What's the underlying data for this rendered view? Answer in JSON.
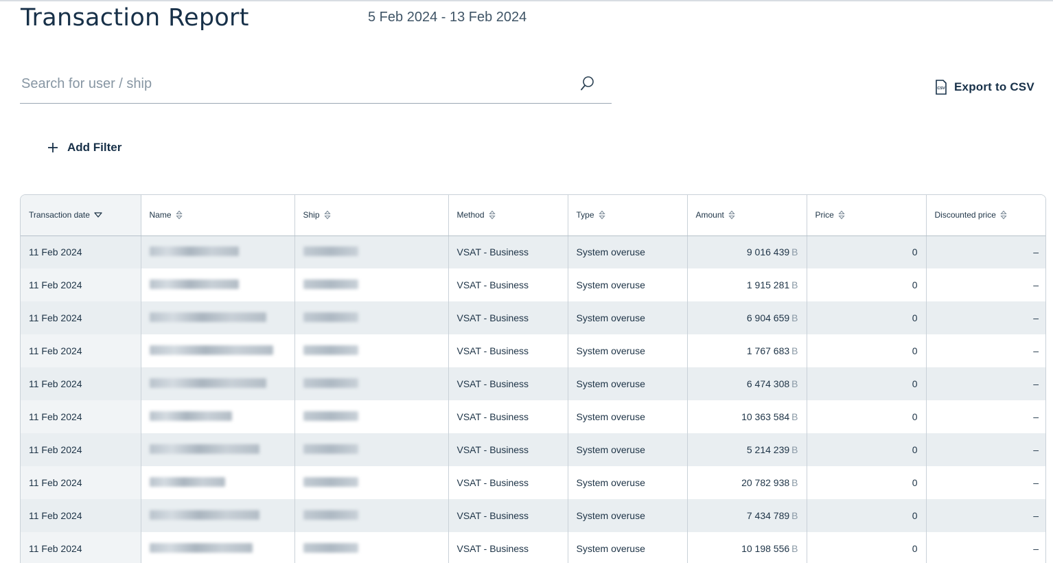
{
  "header": {
    "title": "Transaction Report",
    "date_range": "5 Feb 2024 - 13 Feb 2024"
  },
  "search": {
    "placeholder": "Search for user / ship",
    "value": ""
  },
  "actions": {
    "export_label": "Export to CSV",
    "export_icon_text": "CSV",
    "add_filter_label": "Add Filter"
  },
  "table": {
    "columns": [
      {
        "label": "Transaction date",
        "sort": "desc"
      },
      {
        "label": "Name",
        "sort": "none"
      },
      {
        "label": "Ship",
        "sort": "none"
      },
      {
        "label": "Method",
        "sort": "none"
      },
      {
        "label": "Type",
        "sort": "none"
      },
      {
        "label": "Amount",
        "sort": "none"
      },
      {
        "label": "Price",
        "sort": "none"
      },
      {
        "label": "Discounted price",
        "sort": "none"
      }
    ],
    "rows": [
      {
        "date": "11 Feb 2024",
        "method": "VSAT - Business",
        "type": "System overuse",
        "amount": "9 016 439",
        "unit": "B",
        "price": "0",
        "discounted": "–"
      },
      {
        "date": "11 Feb 2024",
        "method": "VSAT - Business",
        "type": "System overuse",
        "amount": "1 915 281",
        "unit": "B",
        "price": "0",
        "discounted": "–"
      },
      {
        "date": "11 Feb 2024",
        "method": "VSAT - Business",
        "type": "System overuse",
        "amount": "6 904 659",
        "unit": "B",
        "price": "0",
        "discounted": "–"
      },
      {
        "date": "11 Feb 2024",
        "method": "VSAT - Business",
        "type": "System overuse",
        "amount": "1 767 683",
        "unit": "B",
        "price": "0",
        "discounted": "–"
      },
      {
        "date": "11 Feb 2024",
        "method": "VSAT - Business",
        "type": "System overuse",
        "amount": "6 474 308",
        "unit": "B",
        "price": "0",
        "discounted": "–"
      },
      {
        "date": "11 Feb 2024",
        "method": "VSAT - Business",
        "type": "System overuse",
        "amount": "10 363 584",
        "unit": "B",
        "price": "0",
        "discounted": "–"
      },
      {
        "date": "11 Feb 2024",
        "method": "VSAT - Business",
        "type": "System overuse",
        "amount": "5 214 239",
        "unit": "B",
        "price": "0",
        "discounted": "–"
      },
      {
        "date": "11 Feb 2024",
        "method": "VSAT - Business",
        "type": "System overuse",
        "amount": "20 782 938",
        "unit": "B",
        "price": "0",
        "discounted": "–"
      },
      {
        "date": "11 Feb 2024",
        "method": "VSAT - Business",
        "type": "System overuse",
        "amount": "7 434 789",
        "unit": "B",
        "price": "0",
        "discounted": "–"
      },
      {
        "date": "11 Feb 2024",
        "method": "VSAT - Business",
        "type": "System overuse",
        "amount": "10 198 556",
        "unit": "B",
        "price": "0",
        "discounted": "–"
      }
    ]
  },
  "colors": {
    "text": "#1d3346",
    "row_shaded": "#e9eef1",
    "border": "#c9d1d8",
    "muted": "#8a99a6"
  }
}
